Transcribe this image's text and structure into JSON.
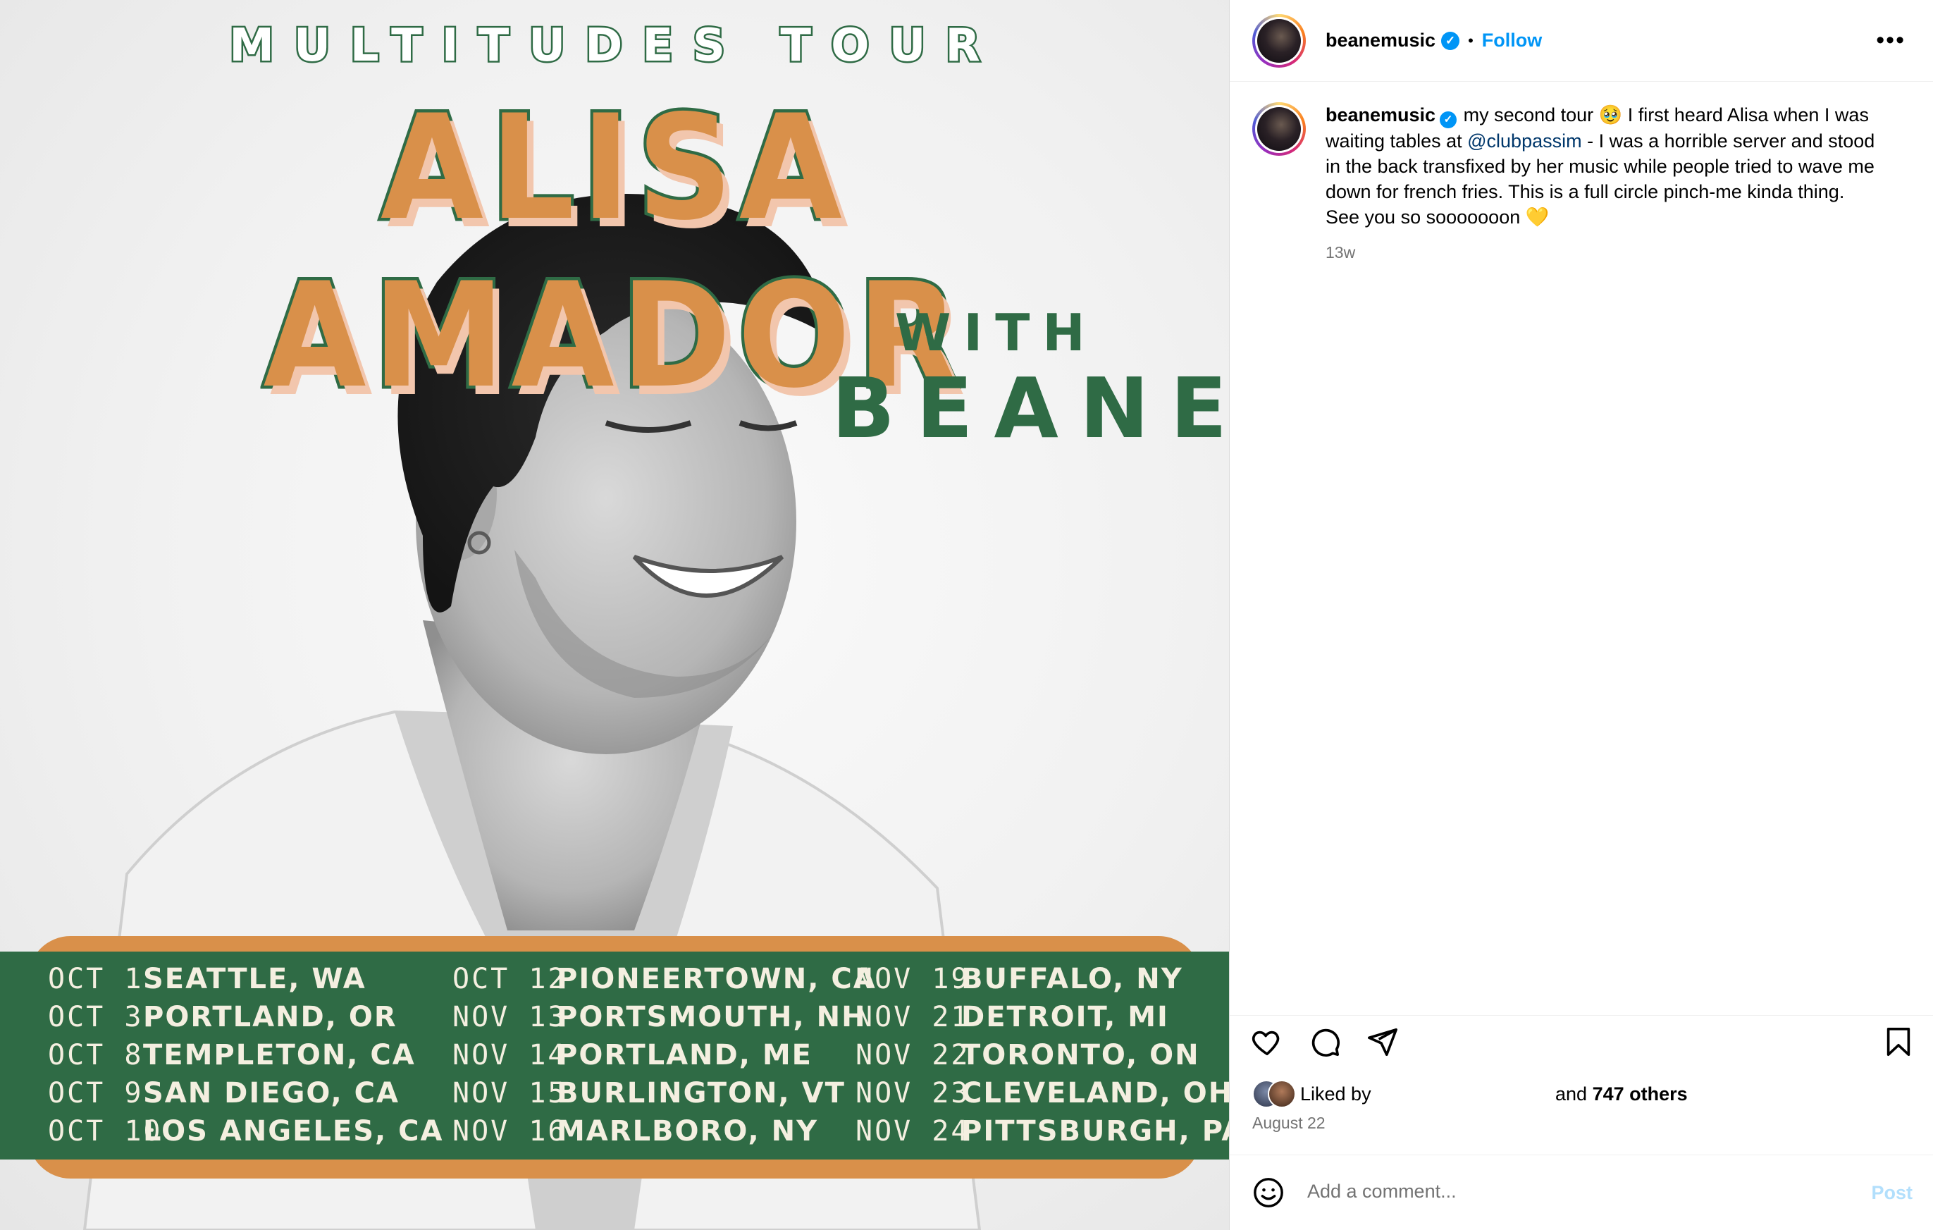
{
  "poster": {
    "tour_title": "MULTITUDES TOUR",
    "headline": "ALISA AMADOR",
    "with_label": "WITH",
    "support_act": "BEANE",
    "colors": {
      "green": "#2f6b45",
      "orange": "#d9904a",
      "cream": "#f4efe0"
    },
    "dates": [
      [
        {
          "day": "OCT 1",
          "city": "SEATTLE, WA"
        },
        {
          "day": "OCT 3",
          "city": "PORTLAND, OR"
        },
        {
          "day": "OCT 8",
          "city": "TEMPLETON, CA"
        },
        {
          "day": "OCT 9",
          "city": "SAN DIEGO, CA"
        },
        {
          "day": "OCT 10",
          "city": "LOS ANGELES, CA"
        }
      ],
      [
        {
          "day": "OCT 12",
          "city": "PIONEERTOWN, CA"
        },
        {
          "day": "NOV 13",
          "city": "PORTSMOUTH, NH"
        },
        {
          "day": "NOV 14",
          "city": "PORTLAND, ME"
        },
        {
          "day": "NOV 15",
          "city": "BURLINGTON, VT"
        },
        {
          "day": "NOV 16",
          "city": "MARLBORO, NY"
        }
      ],
      [
        {
          "day": "NOV 19",
          "city": "BUFFALO, NY"
        },
        {
          "day": "NOV 21",
          "city": "DETROIT, MI"
        },
        {
          "day": "NOV 22",
          "city": "TORONTO, ON"
        },
        {
          "day": "NOV 23",
          "city": "CLEVELAND, OH"
        },
        {
          "day": "NOV 24",
          "city": "PITTSBURGH, PA"
        }
      ]
    ]
  },
  "header": {
    "username": "beanemusic",
    "separator": "•",
    "follow_label": "Follow",
    "more_icon": "more-horizontal-icon"
  },
  "caption": {
    "username": "beanemusic",
    "text_part1": " my second tour 🥹 I first heard Alisa when I was waiting tables at ",
    "mention": "@clubpassim",
    "text_part2": " - I was a horrible server and stood in the back transfixed by her music while people tried to wave me down for french fries. This is a full circle pinch-me kinda thing. See you so sooooooon 💛",
    "time_ago": "13w"
  },
  "actions": {
    "icons": [
      "heart-icon",
      "comment-icon",
      "share-icon",
      "bookmark-icon"
    ],
    "liked_by": "Liked by",
    "and_label": "and",
    "others_count": "747 others",
    "date": "August 22"
  },
  "comment": {
    "placeholder": "Add a comment...",
    "post_label": "Post"
  },
  "colors": {
    "accent": "#0095f6",
    "mention": "#00376b",
    "muted": "#737373",
    "post_disabled": "#b2dffc"
  }
}
